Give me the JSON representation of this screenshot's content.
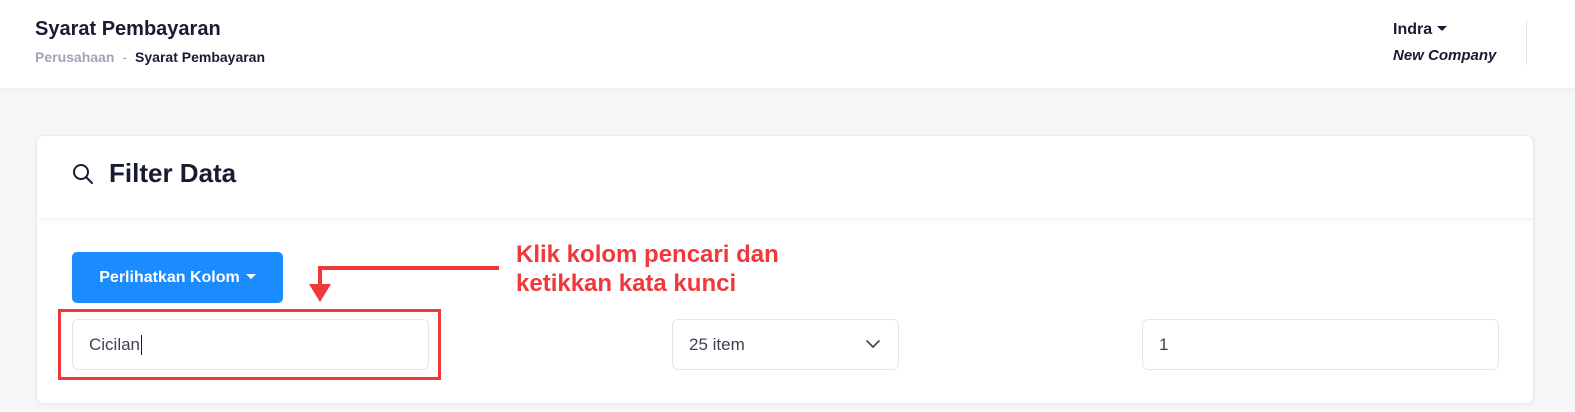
{
  "header": {
    "title": "Syarat Pembayaran",
    "breadcrumb": {
      "parent": "Perusahaan",
      "separator": "-",
      "current": "Syarat Pembayaran"
    },
    "user": {
      "name": "Indra",
      "company": "New Company"
    }
  },
  "filter_card": {
    "title": "Filter Data",
    "icon": "search-icon",
    "show_columns_button": "Perlihatkan Kolom",
    "search_input": {
      "value": "Cicilan"
    },
    "per_page_select": {
      "selected": "25 item"
    },
    "page_input": {
      "value": "1"
    }
  },
  "annotation": {
    "line1": "Klik kolom pencari dan",
    "line2": "ketikkan kata kunci",
    "color": "#f0383a"
  },
  "colors": {
    "primary": "#1a8cff",
    "annotation": "#f0383a",
    "text_dark": "#181c32",
    "text_muted": "#a1a5b7"
  }
}
